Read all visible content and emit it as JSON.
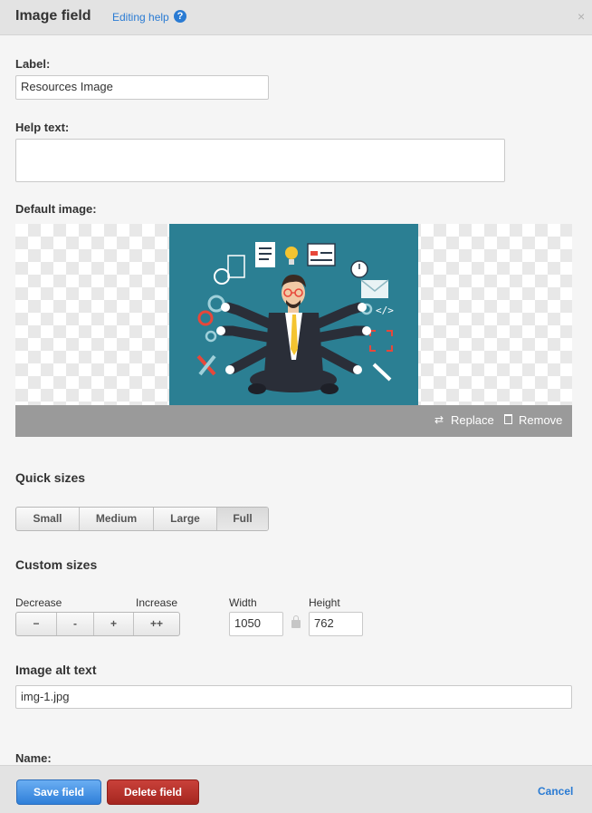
{
  "header": {
    "title": "Image field",
    "help_link": "Editing help",
    "help_icon": "?",
    "close_icon": "×"
  },
  "label": {
    "heading": "Label:",
    "value": "Resources Image"
  },
  "help_text": {
    "heading": "Help text:",
    "value": ""
  },
  "default_image": {
    "heading": "Default image:",
    "replace_label": "Replace",
    "remove_label": "Remove",
    "image_colors": {
      "background": "#2b7f93",
      "suit": "#2a2e38",
      "accent": "#e8473a",
      "tie": "#f4c430"
    }
  },
  "quick_sizes": {
    "heading": "Quick sizes",
    "options": [
      "Small",
      "Medium",
      "Large",
      "Full"
    ],
    "selected": "Full"
  },
  "custom_sizes": {
    "heading": "Custom sizes",
    "decrease_label": "Decrease",
    "increase_label": "Increase",
    "buttons": [
      "−",
      "-",
      "+",
      "++"
    ],
    "width_label": "Width",
    "width_value": "1050",
    "height_label": "Height",
    "height_value": "762"
  },
  "alt_text": {
    "heading": "Image alt text",
    "value": "img-1.jpg"
  },
  "name": {
    "heading": "Name:"
  },
  "footer": {
    "save_label": "Save field",
    "delete_label": "Delete field",
    "cancel_label": "Cancel"
  }
}
